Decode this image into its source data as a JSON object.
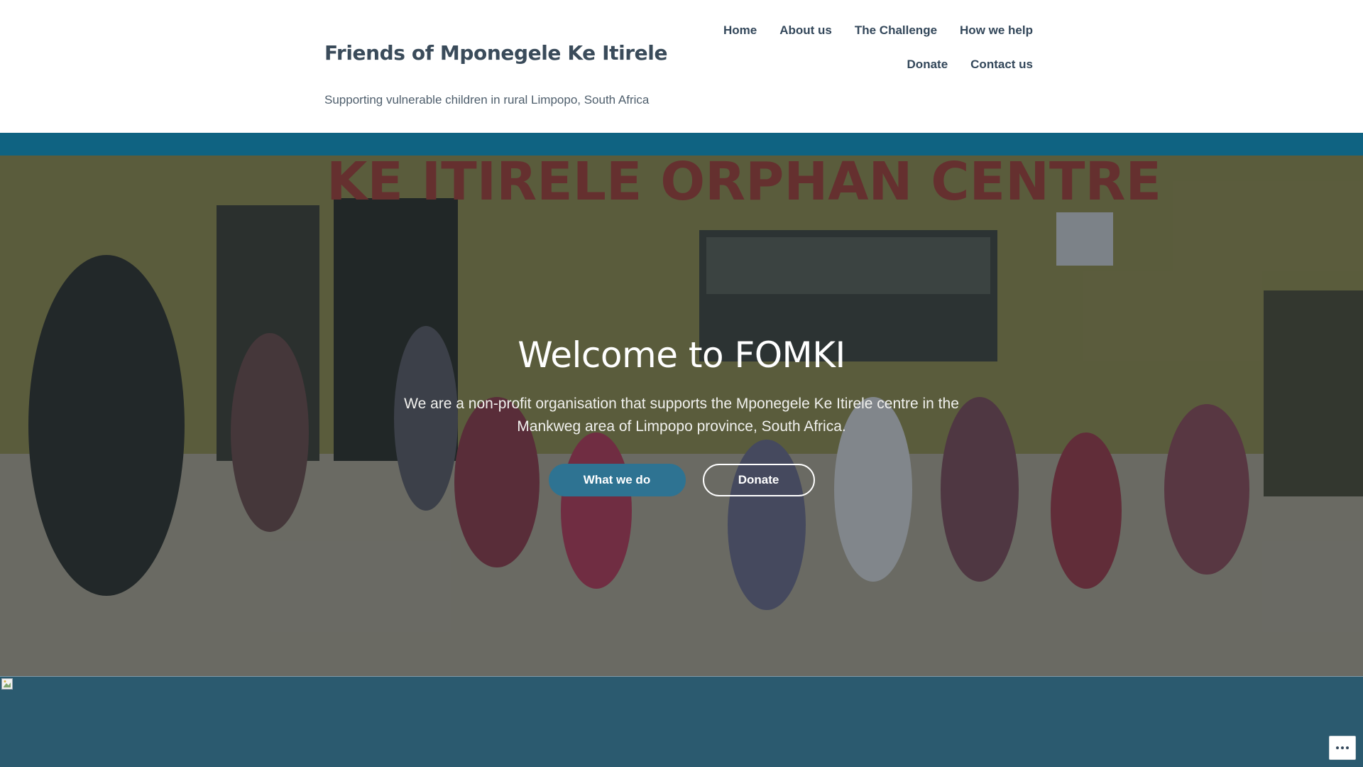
{
  "header": {
    "site_title": "Friends of Mponegele Ke Itirele",
    "tagline": "Supporting vulnerable children in rural Limpopo, South Africa"
  },
  "nav": {
    "items": [
      {
        "label": "Home"
      },
      {
        "label": "About us"
      },
      {
        "label": "The Challenge"
      },
      {
        "label": "How we help"
      },
      {
        "label": "Donate"
      },
      {
        "label": "Contact us"
      }
    ]
  },
  "hero": {
    "background_sign_text": "KE ITIRELE ORPHAN CENTRE",
    "title": "Welcome to FOMKI",
    "text": "We are a non-profit organisation that supports the Mponegele Ke Itirele centre in the Mankweg area of Limpopo province, South Africa.",
    "primary_button": "What we do",
    "secondary_button": "Donate"
  },
  "lower_section": {
    "broken_image_icon": "broken-image-icon",
    "more_icon": "ellipsis-icon"
  },
  "colors": {
    "teal_stripe": "#0f6382",
    "primary_button": "#2e7392",
    "lower_band": "#2b5a6f",
    "title_text": "#3a4b5a"
  }
}
